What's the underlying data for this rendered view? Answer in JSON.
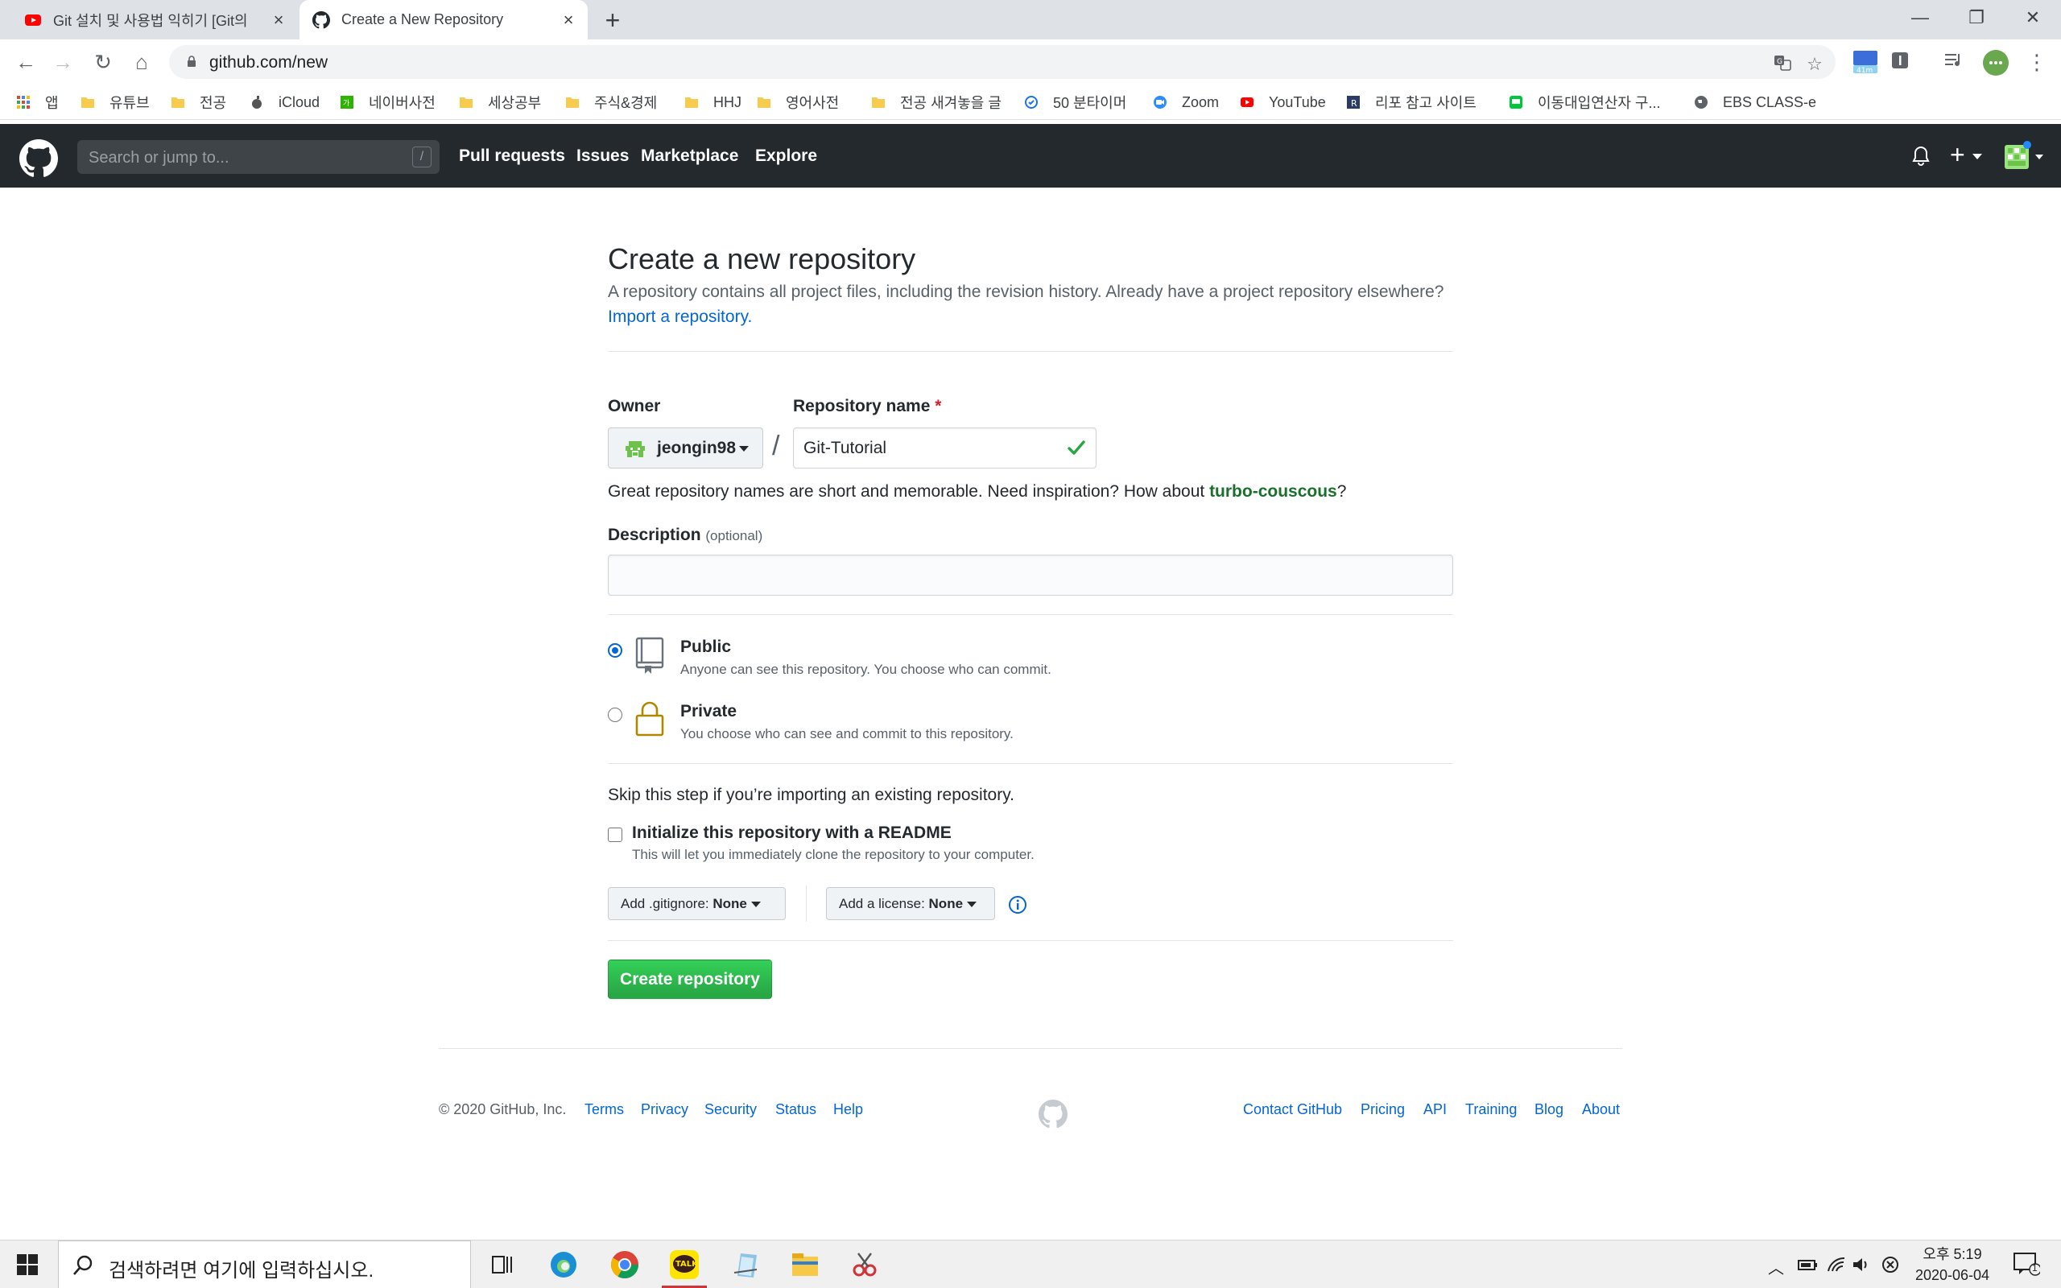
{
  "browser": {
    "tabs": [
      {
        "title": "Git 설치 및 사용법 익히기 [Git의",
        "favicon": "youtube-icon",
        "active": false
      },
      {
        "title": "Create a New Repository",
        "favicon": "github-icon",
        "active": true
      }
    ],
    "new_tab": "+",
    "window_controls": {
      "minimize": "—",
      "restore": "❐",
      "close": "✕"
    },
    "nav": {
      "back": "←",
      "forward": "→",
      "reload": "↻",
      "home": "⌂"
    },
    "url": "github.com/new",
    "extension_badge": "41m",
    "bookmarks": [
      {
        "label": "앱",
        "icon": "apps-grid-icon"
      },
      {
        "label": "유튜브",
        "icon": "folder-icon"
      },
      {
        "label": "전공",
        "icon": "folder-icon"
      },
      {
        "label": "iCloud",
        "icon": "apple-icon"
      },
      {
        "label": "네이버사전",
        "icon": "naver-icon"
      },
      {
        "label": "세상공부",
        "icon": "folder-icon"
      },
      {
        "label": "주식&경제",
        "icon": "folder-icon"
      },
      {
        "label": "HHJ",
        "icon": "folder-icon"
      },
      {
        "label": "영어사전",
        "icon": "folder-icon"
      },
      {
        "label": "전공 새겨놓을 글",
        "icon": "folder-icon"
      },
      {
        "label": "50 분타이머",
        "icon": "timer-icon"
      },
      {
        "label": "Zoom",
        "icon": "zoom-icon"
      },
      {
        "label": "YouTube",
        "icon": "youtube-icon"
      },
      {
        "label": "리포 참고 사이트",
        "icon": "r-icon"
      },
      {
        "label": "이동대입연산자 구...",
        "icon": "chat-icon"
      },
      {
        "label": "EBS CLASS-e",
        "icon": "globe-icon"
      }
    ]
  },
  "github_header": {
    "search_placeholder": "Search or jump to...",
    "search_shortcut": "/",
    "nav": [
      "Pull requests",
      "Issues",
      "Marketplace",
      "Explore"
    ],
    "new_menu": "+",
    "colors": {
      "header_bg": "#24292e"
    }
  },
  "form": {
    "title": "Create a new repository",
    "lead": "A repository contains all project files, including the revision history. Already have a project repository elsewhere?",
    "import_link": "Import a repository.",
    "owner_label": "Owner",
    "owner_value": "jeongin98",
    "repo_label": "Repository name",
    "required_mark": "*",
    "separator": "/",
    "repo_value": "Git-Tutorial",
    "hint_prefix": "Great repository names are short and memorable. Need inspiration? How about ",
    "hint_suggestion": "turbo-couscous",
    "hint_suffix": "?",
    "description_label": "Description",
    "description_optional": "(optional)",
    "description_value": "",
    "visibility": [
      {
        "title": "Public",
        "subtitle": "Anyone can see this repository. You choose who can commit.",
        "selected": true,
        "icon": "repo-icon"
      },
      {
        "title": "Private",
        "subtitle": "You choose who can see and commit to this repository.",
        "selected": false,
        "icon": "lock-icon"
      }
    ],
    "skip_text": "Skip this step if you’re importing an existing repository.",
    "readme_title": "Initialize this repository with a README",
    "readme_sub": "This will let you immediately clone the repository to your computer.",
    "readme_checked": false,
    "gitignore_label": "Add .gitignore:",
    "gitignore_value": "None",
    "license_label": "Add a license:",
    "license_value": "None",
    "submit": "Create repository",
    "colors": {
      "submit": "#28a745",
      "link": "#0366d6",
      "suggestion": "#1b6f2c"
    }
  },
  "footer": {
    "copyright": "© 2020 GitHub, Inc.",
    "left_links": [
      "Terms",
      "Privacy",
      "Security",
      "Status",
      "Help"
    ],
    "right_links": [
      "Contact GitHub",
      "Pricing",
      "API",
      "Training",
      "Blog",
      "About"
    ]
  },
  "taskbar": {
    "search_placeholder": "검색하려면 여기에 입력하십시오.",
    "apps": [
      "task-view-icon",
      "edge-icon",
      "chrome-icon",
      "kakaotalk-icon",
      "notepad-icon",
      "file-explorer-icon",
      "snipping-tool-icon"
    ],
    "kakao_label": "TALK",
    "time": "오후 5:19",
    "date": "2020-06-04",
    "notification_count": "1"
  }
}
